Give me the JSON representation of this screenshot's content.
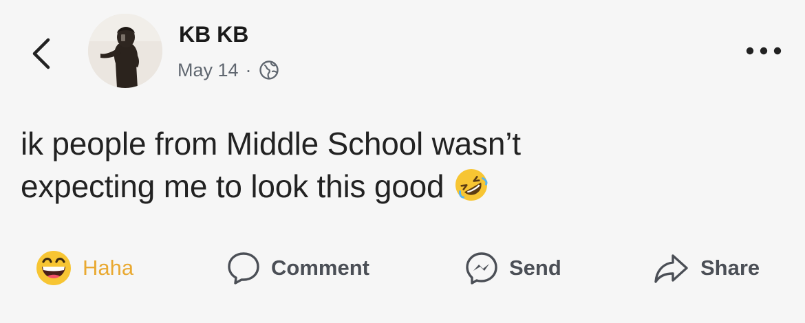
{
  "post": {
    "author": "KB KB",
    "date": "May 14",
    "separator": "·",
    "audience_icon": "globe-icon",
    "text_lines": [
      "ik people from Middle School wasn’t",
      "expecting me to look this good"
    ],
    "inline_emoji": "rolling-on-floor-laughing-emoji"
  },
  "actions": {
    "haha_label": "Haha",
    "comment_label": "Comment",
    "send_label": "Send",
    "share_label": "Share"
  },
  "colors": {
    "background": "#f6f6f6",
    "reaction_haha": "#e9a931",
    "text_secondary": "#606770",
    "action_text": "#4b4f56"
  },
  "icons": {
    "back": "chevron-left-icon",
    "more": "more-dots-icon",
    "haha": "haha-reaction-icon",
    "comment": "comment-bubble-icon",
    "send": "messenger-icon",
    "share": "share-arrow-icon"
  }
}
